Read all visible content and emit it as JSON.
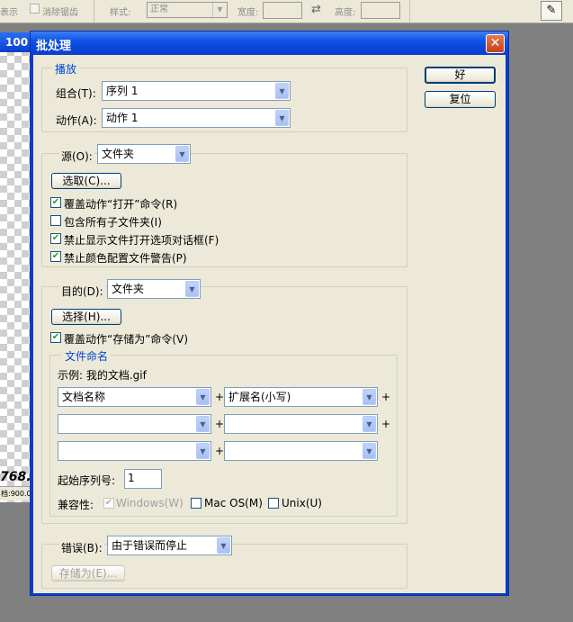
{
  "options_bar": {
    "left_item": "表示",
    "anti_alias": "消除锯齿",
    "style_label": "样式:",
    "style_value": "正常",
    "width_label": "宽度:",
    "height_label": "高度:"
  },
  "background_doc": {
    "title": "100",
    "status": "档:900.0",
    "canvas_text": "768."
  },
  "dialog": {
    "title": "批处理",
    "close": "✕",
    "ok_label": "好",
    "reset_label": "复位",
    "play": {
      "legend": "播放",
      "set_label": "组合(T):",
      "set_value": "序列 1",
      "action_label": "动作(A):",
      "action_value": "动作 1"
    },
    "source": {
      "label": "源(O):",
      "value": "文件夹",
      "choose_button": "选取(C)...",
      "options": [
        {
          "label": "覆盖动作“打开”命令(R)",
          "checked": true
        },
        {
          "label": "包含所有子文件夹(I)",
          "checked": false
        },
        {
          "label": "禁止显示文件打开选项对话框(F)",
          "checked": true
        },
        {
          "label": "禁止颜色配置文件警告(P)",
          "checked": true
        }
      ]
    },
    "destination": {
      "label": "目的(D):",
      "value": "文件夹",
      "choose_button": "选择(H)...",
      "override_save": "覆盖动作“存储为”命令(V)",
      "override_checked": true,
      "file_naming": {
        "legend": "文件命名",
        "example": "示例: 我的文档.gif",
        "fields": [
          [
            "文档名称",
            "扩展名(小写)"
          ],
          [
            "",
            ""
          ],
          [
            "",
            ""
          ]
        ],
        "plus": "+",
        "serial_label": "起始序列号:",
        "serial_value": "1",
        "compat_label": "兼容性:",
        "compat": [
          {
            "label": "Windows(W)",
            "checked": true,
            "disabled": true
          },
          {
            "label": "Mac OS(M)",
            "checked": false,
            "disabled": false
          },
          {
            "label": "Unix(U)",
            "checked": false,
            "disabled": false
          }
        ]
      }
    },
    "errors": {
      "label": "错误(B):",
      "value": "由于错误而停止",
      "save_as_button": "存储为(E)..."
    }
  },
  "colors": {
    "titlebar": "#0a46d8",
    "face": "#ece9d8",
    "groupbox_text": "#0046d5",
    "check_mark": "#21a121"
  }
}
